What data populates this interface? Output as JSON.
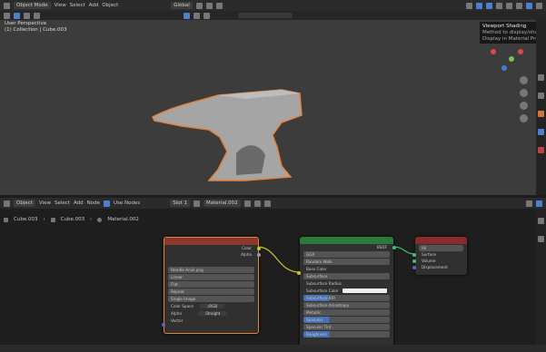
{
  "header": {
    "mode": "Object Mode",
    "menus": [
      "View",
      "Select",
      "Add",
      "Object"
    ],
    "transform_orientation": "Global"
  },
  "viewport": {
    "info_line1": "User Perspective",
    "info_line2": "(1) Collection | Cube.003",
    "tooltip": [
      "Viewport Shading",
      "Method to display/shade",
      "Display in Material Preview"
    ]
  },
  "node_editor": {
    "header": {
      "type": "Object",
      "menus": [
        "View",
        "Select",
        "Add",
        "Node"
      ],
      "use_nodes_label": "Use Nodes",
      "slot": "Slot 1",
      "material": "Material.002"
    },
    "breadcrumb": [
      "Cube.003",
      "Cube.003",
      "Material.002"
    ],
    "image_node": {
      "outputs": [
        "Color",
        "Alpha"
      ],
      "image_name": "Handle Anvil.png",
      "options": [
        "Linear",
        "Flat",
        "Repeat",
        "Single Image"
      ],
      "color_space_label": "Color Space",
      "color_space": "sRGB",
      "alpha_label": "Alpha",
      "alpha": "Straight",
      "vector_label": "Vector"
    },
    "bsdf_node": {
      "output": "BSDF",
      "distribution": "GGX",
      "subsurface_method": "Random Walk",
      "inputs": [
        "Base Color",
        "Subsurface",
        "Subsurface Radius",
        "Subsurface Color",
        "Subsurface IOR",
        "Subsurface Anisotropy",
        "Metallic",
        "Specular",
        "Specular Tint",
        "Roughness"
      ]
    },
    "output_node": {
      "target": "All",
      "inputs": [
        "Surface",
        "Volume",
        "Displacement"
      ]
    }
  },
  "colors": {
    "selection": "#e8823a",
    "image_header": "#8a3a2a",
    "bsdf_header": "#2c7a3a",
    "output_header": "#8a2a2a"
  }
}
